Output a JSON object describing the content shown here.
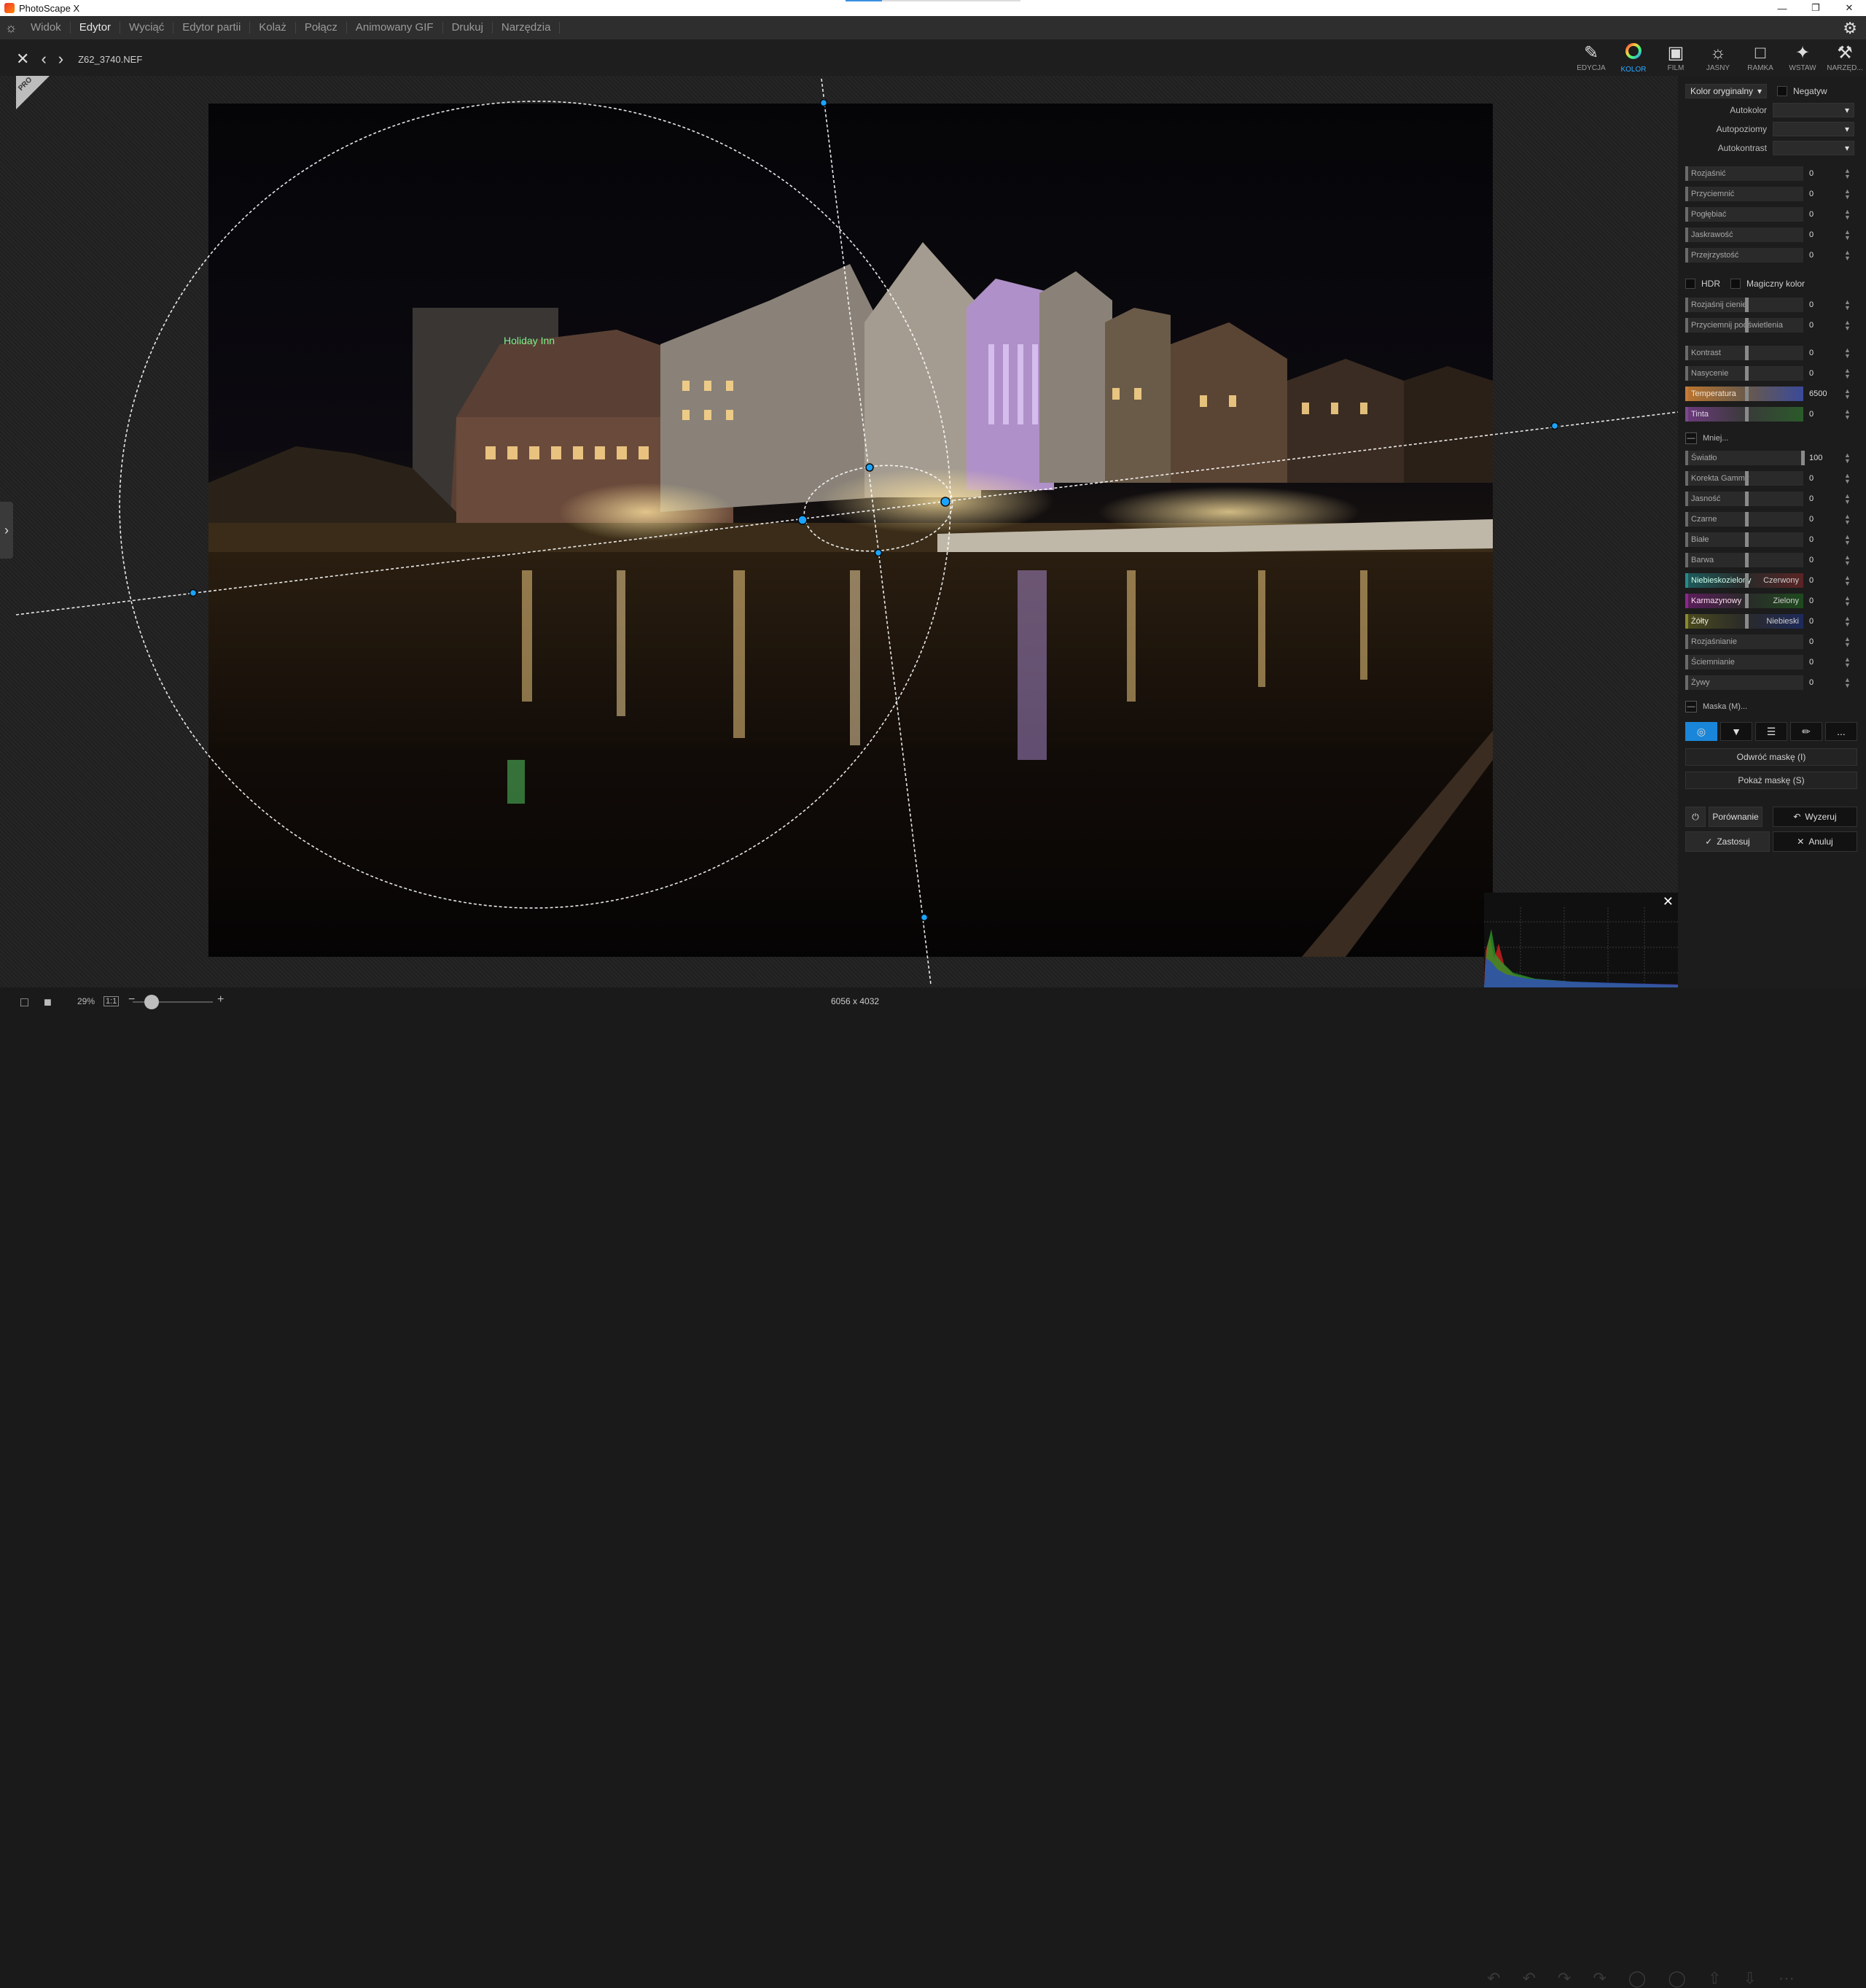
{
  "window": {
    "title": "PhotoScape X"
  },
  "menu": {
    "items": [
      "Widok",
      "Edytor",
      "Wyciąć",
      "Edytor partii",
      "Kolaż",
      "Połącz",
      "Animowany GIF",
      "Drukuj",
      "Narzędzia"
    ],
    "active": "Edytor"
  },
  "toolbar": {
    "filename": "Z62_3740.NEF"
  },
  "tabs": [
    {
      "label": "EDYCJA",
      "icon": "edit-icon"
    },
    {
      "label": "KOLOR",
      "icon": "color-wheel-icon",
      "active": true
    },
    {
      "label": "FILM",
      "icon": "film-icon"
    },
    {
      "label": "JASNY",
      "icon": "brightness-icon"
    },
    {
      "label": "RAMKA",
      "icon": "frame-icon"
    },
    {
      "label": "WSTAW",
      "icon": "insert-icon"
    },
    {
      "label": "NARZĘD...",
      "icon": "tools-icon"
    }
  ],
  "panel": {
    "color_mode": "Kolor oryginalny",
    "negative_label": "Negatyw",
    "autokolor_label": "Autokolor",
    "autopoziomy_label": "Autopoziomy",
    "autokontrast_label": "Autokontrast",
    "sliders1": [
      {
        "label": "Rozjaśnić",
        "value": "0"
      },
      {
        "label": "Przyciemnić",
        "value": "0"
      },
      {
        "label": "Pogłębiać",
        "value": "0"
      },
      {
        "label": "Jaskrawość",
        "value": "0"
      },
      {
        "label": "Przejrzystość",
        "value": "0"
      }
    ],
    "hdr_label": "HDR",
    "magic_label": "Magiczny kolor",
    "sliders2": [
      {
        "label": "Rozjaśnij cienie",
        "value": "0"
      },
      {
        "label": "Przyciemnij podświetlenia",
        "value": "0"
      }
    ],
    "sliders3": [
      {
        "label": "Kontrast",
        "value": "0"
      },
      {
        "label": "Nasycenie",
        "value": "0"
      },
      {
        "label": "Temperatura",
        "value": "6500"
      },
      {
        "label": "Tinta",
        "value": "0"
      }
    ],
    "less_label": "Mniej...",
    "sliders4": [
      {
        "label": "Światło",
        "value": "100"
      },
      {
        "label": "Korekta Gammy",
        "value": "0"
      },
      {
        "label": "Jasność",
        "value": "0"
      },
      {
        "label": "Czarne",
        "value": "0"
      },
      {
        "label": "Białe",
        "value": "0"
      },
      {
        "label": "Barwa",
        "value": "0"
      },
      {
        "label": "Niebieskozielony",
        "right": "Czerwony",
        "value": "0"
      },
      {
        "label": "Karmazynowy",
        "right": "Zielony",
        "value": "0"
      },
      {
        "label": "Żółty",
        "right": "Niebieski",
        "value": "0"
      },
      {
        "label": "Rozjaśnianie",
        "value": "0"
      },
      {
        "label": "Ściemnianie",
        "value": "0"
      },
      {
        "label": "Żywy",
        "value": "0"
      }
    ],
    "mask_label": "Maska (M)...",
    "mask_more": "...",
    "invert_mask": "Odwróć maskę (I)",
    "show_mask": "Pokaż maskę (S)",
    "compare": "Porównanie",
    "reset": "Wyzeruj",
    "apply": "Zastosuj",
    "cancel": "Anuluj"
  },
  "photo": {
    "sign_text": "Holiday Inn"
  },
  "status": {
    "zoom": "29%",
    "one_to_one": "1:1",
    "dims": "6056 x 4032"
  },
  "colors": {
    "accent": "#2fa8ff",
    "temperature": "#c87a3a",
    "tint": "#7a4a8a"
  }
}
